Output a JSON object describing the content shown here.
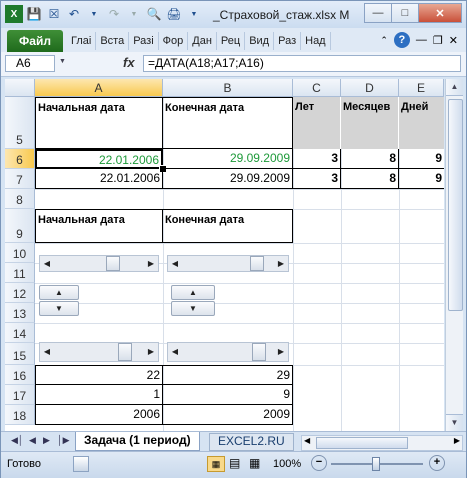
{
  "titlebar": {
    "title": "_Страховой_стаж.xlsx  M"
  },
  "ribbon": {
    "file_tab": "Файл",
    "tabs": [
      "Глаі",
      "Вста",
      "Разі",
      "Фор",
      "Дан",
      "Рец",
      "Вид",
      "Раз",
      "Над"
    ]
  },
  "formula_bar": {
    "name_box": "A6",
    "fx": "fx",
    "formula": "=ДАТА(A18;A17;A16)"
  },
  "columns": [
    "A",
    "B",
    "C",
    "D",
    "E"
  ],
  "rows": [
    "5",
    "6",
    "7",
    "8",
    "9",
    "10",
    "11",
    "12",
    "13",
    "14",
    "15",
    "16",
    "17",
    "18"
  ],
  "cells": {
    "A5": "Начальная дата",
    "B5": "Конечная дата",
    "C5": "Лет",
    "D5": "Месяцев",
    "E5": "Дней",
    "A6": "22.01.2006",
    "B6": "29.09.2009",
    "C6": "3",
    "D6": "8",
    "E6": "9",
    "A7": "22.01.2006",
    "B7": "29.09.2009",
    "C7": "3",
    "D7": "8",
    "E7": "9",
    "A9": "Начальная дата",
    "B9": "Конечная дата",
    "A16": "22",
    "B16": "29",
    "A17": "1",
    "B17": "9",
    "A18": "2006",
    "B18": "2009"
  },
  "sheets": {
    "active": "Задача (1 период)",
    "other": "EXCEL2.RU"
  },
  "status": {
    "ready": "Готово",
    "zoom": "100%"
  },
  "colors": {
    "green_text": "#1e9a3a",
    "header_gray": "#d4d4d4",
    "selected_header": "#f8c94f"
  }
}
